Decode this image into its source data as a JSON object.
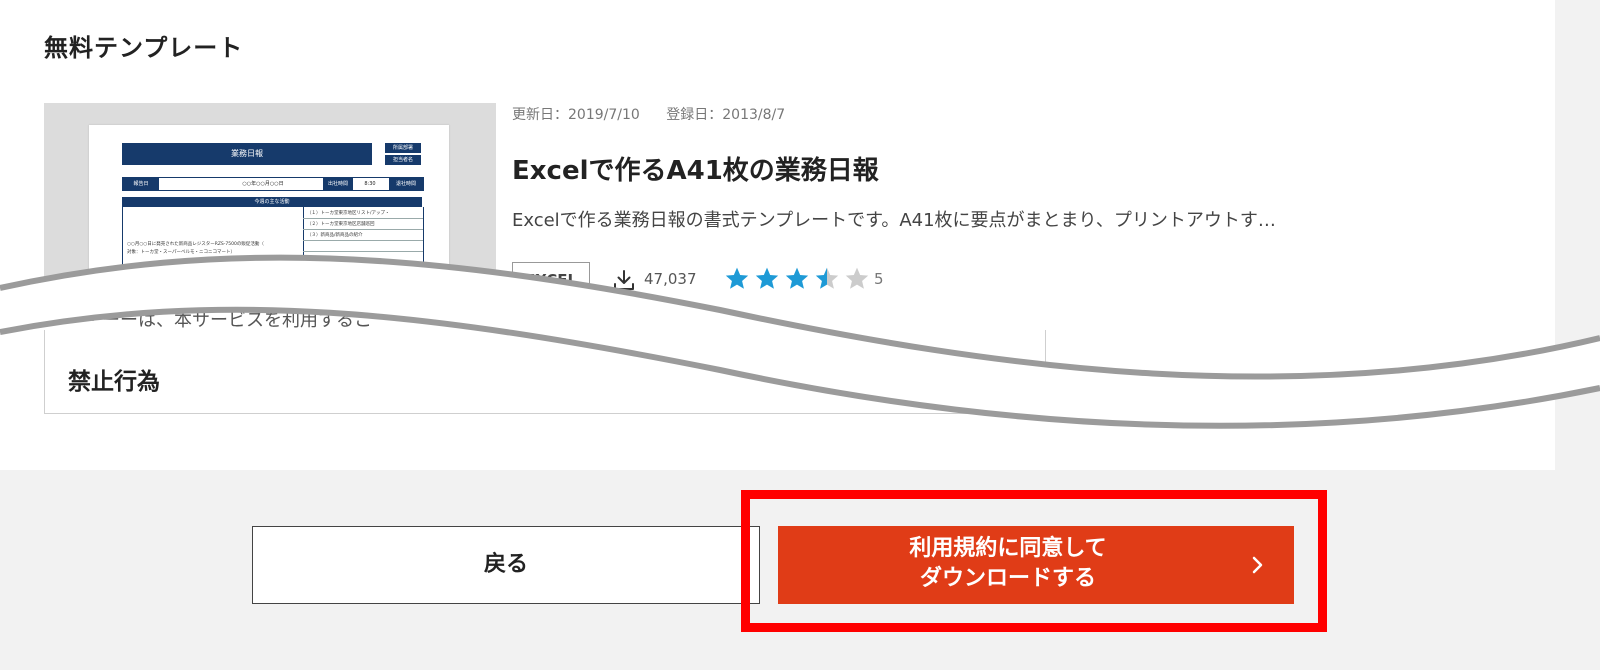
{
  "section": {
    "title": "無料テンプレート"
  },
  "thumbnail": {
    "doc_title": "業務日報",
    "side_label_1": "所属部署",
    "side_label_2": "担当者名",
    "row_date_label": "報告日",
    "row_date_value": "○○年○○月○○日",
    "row_time_label": "出社時間",
    "row_time_value": "8:30",
    "row_leave_label": "退社時間",
    "table_head": "今週の主な活動",
    "left_text_1": "○○月○○日に発売された新商品レジスターRZS-7500の販促活動（",
    "left_text_2": "対象：トーカ堂・スーパーベルモ・ニコニコマート）",
    "right_1": "（１）トーカ堂東京地区リスト/アップ・",
    "right_2": "（２）トーカ堂東京地区店舗巡回",
    "right_3": "（３）新商品/新商品の紹介"
  },
  "card": {
    "updated": "更新日：2019/7/10",
    "registered": "登録日：2013/8/7",
    "title": "Excelで作るA41枚の業務日報",
    "description": "Excelで作る業務日報の書式テンプレートです。A41枚に要点がまとまり、プリントアウトす…",
    "tag": "EXCEL",
    "download_icon": "download-icon",
    "download_count": "47,037",
    "rating_value": 3.5,
    "rating_max": 5,
    "rating_count": "5",
    "star_color": "#1e9ad6",
    "star_empty_color": "#cccccc"
  },
  "terms": {
    "partial_text": "ー・ーーは、本サービスを利用するこ",
    "heading": "禁止行為"
  },
  "buttons": {
    "back_label": "戻る",
    "download_line1": "利用規約に同意して",
    "download_line2": "ダウンロードする",
    "download_icon": "chevron-right-icon",
    "download_color": "#e03c17"
  },
  "annotation": {
    "highlight_color": "#ff0000"
  }
}
